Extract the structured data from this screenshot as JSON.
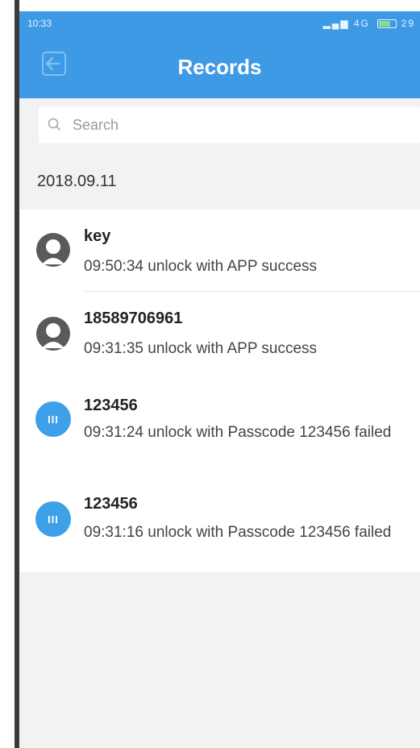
{
  "statusbar": {
    "time": "10:33",
    "network": "4G",
    "battery": "29"
  },
  "header": {
    "title": "Records"
  },
  "search": {
    "placeholder": "Search"
  },
  "date_group": "2018.09.11",
  "records": [
    {
      "name": "key",
      "time": "09:50:34",
      "action": "unlock with APP success",
      "icon": "user-icon"
    },
    {
      "name": "18589706961",
      "time": "09:31:35",
      "action": "unlock with APP success",
      "icon": "user-icon"
    },
    {
      "name": "123456",
      "time": "09:31:24",
      "action": "unlock with Passcode 123456 failed",
      "icon": "passcode-icon"
    },
    {
      "name": "123456",
      "time": "09:31:16",
      "action": "unlock with Passcode 123456 failed",
      "icon": "passcode-icon"
    }
  ],
  "colors": {
    "primary": "#3f9ae6",
    "background": "#f2f2f2"
  }
}
